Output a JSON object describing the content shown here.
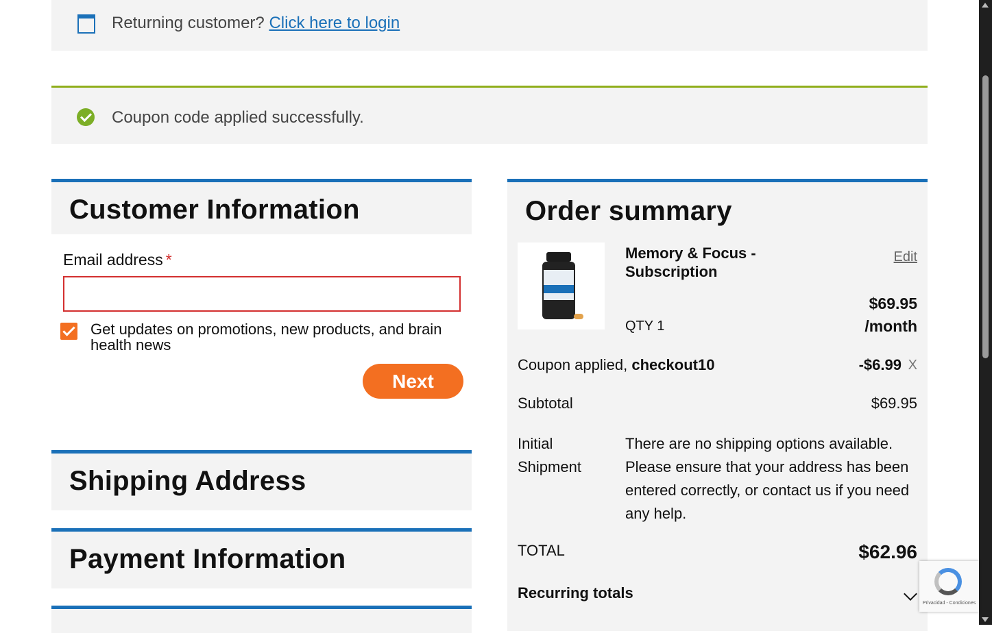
{
  "notices": {
    "returning_prefix": "Returning customer?",
    "login_link": "Click here to login",
    "coupon_success": "Coupon code applied successfully."
  },
  "customer": {
    "title": "Customer Information",
    "email_label": "Email address",
    "required_mark": "*",
    "email_value": "",
    "newsletter_label": "Get updates on promotions, new products, and brain health news",
    "newsletter_checked": true,
    "next_label": "Next"
  },
  "sections": {
    "shipping_title": "Shipping Address",
    "payment_title": "Payment Information"
  },
  "order": {
    "title": "Order summary",
    "product": {
      "name": "Memory & Focus - Subscription",
      "edit": "Edit",
      "price": "$69.95",
      "period": "/month",
      "qty": "QTY 1"
    },
    "coupon_prefix": "Coupon applied,",
    "coupon_code": "checkout10",
    "coupon_amount": "-$6.99",
    "coupon_remove": "X",
    "subtotal_label": "Subtotal",
    "subtotal_value": "$69.95",
    "shipment_label": "Initial Shipment",
    "shipment_message": "There are no shipping options available. Please ensure that your address has been entered correctly, or contact us if you need any help.",
    "total_label": "TOTAL",
    "total_value": "$62.96",
    "recurring_label": "Recurring totals"
  },
  "recaptcha": {
    "footer": "Privacidad - Condiciones"
  },
  "colors": {
    "accent_blue": "#1a70b8",
    "accent_orange": "#f36f21",
    "success_green": "#7cae26",
    "error_red": "#d32f2f"
  },
  "icons": {
    "login_notice": "window-icon",
    "coupon_notice": "check-circle-icon",
    "recurring": "chevron-down-icon"
  }
}
